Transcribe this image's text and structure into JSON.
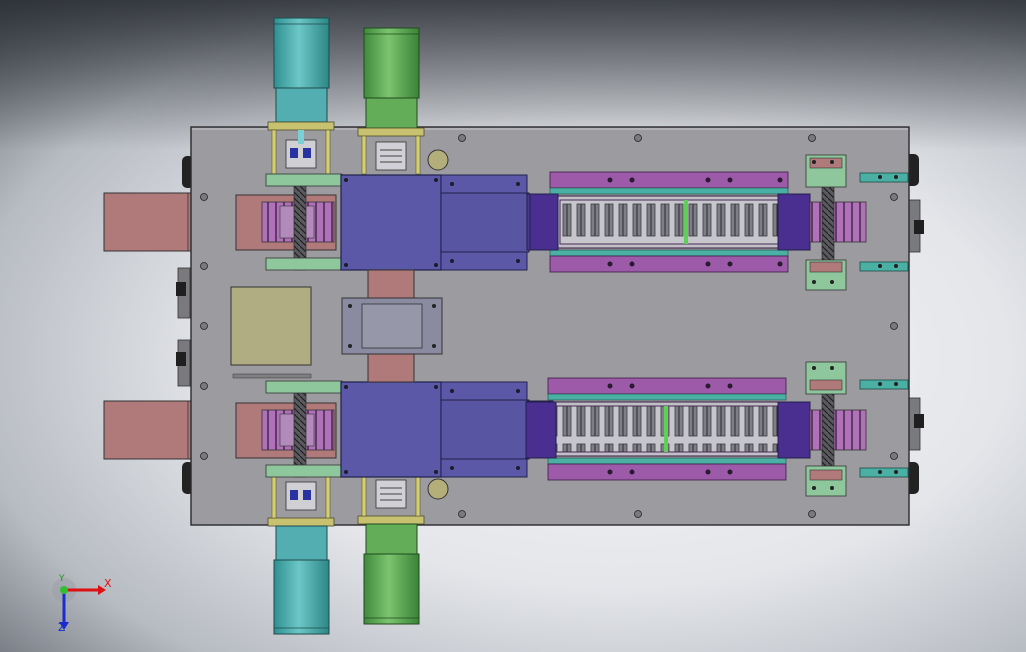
{
  "viewport": {
    "background_center": "#f4f5f7",
    "background_edge": "#5a5f67"
  },
  "colors": {
    "plate": "#9a9a9c",
    "purple": "#5b58a8",
    "violet": "#9c5aa8",
    "teal": "#49a7a8",
    "motor_teal": "#4aa6a5",
    "motor_green": "#56a050",
    "pink": "#b07878",
    "mint": "#8fc79c",
    "khaki": "#b0ad82"
  },
  "triad": {
    "x_label": "X",
    "y_label": "Y",
    "z_label": "Z"
  }
}
